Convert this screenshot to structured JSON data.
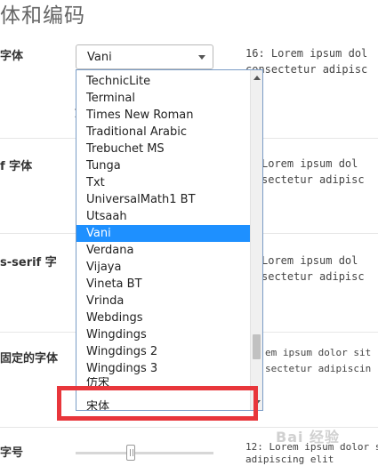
{
  "header": {
    "title": "体和编码"
  },
  "rows": {
    "standard": {
      "label": "字体",
      "preview": [
        "16: Lorem ipsum dol",
        "consectetur adipisc"
      ]
    },
    "serif": {
      "label": "f 字体",
      "preview": [
        "Lorem ipsum dol",
        "sectetur adipisc"
      ]
    },
    "sans": {
      "label": "s-serif 字",
      "preview": [
        "Lorem ipsum dol",
        "sectetur adipisc"
      ]
    },
    "fixed": {
      "label": "固定的字体",
      "preview": [
        "em ipsum dolor sit",
        "sectetur adipiscin"
      ]
    },
    "size": {
      "label": "字号",
      "preview": [
        "12: Lorem ipsum dolor sit a",
        "adipiscing elit"
      ]
    }
  },
  "font_select": {
    "value": "Vani",
    "options": [
      "TechnicLite",
      "Terminal",
      "Times New Roman",
      "Traditional Arabic",
      "Trebuchet MS",
      "Tunga",
      "Txt",
      "UniversalMath1 BT",
      "Utsaah",
      "Vani",
      "Verdana",
      "Vijaya",
      "Vineta BT",
      "Vrinda",
      "Webdings",
      "Wingdings",
      "Wingdings 2",
      "Wingdings 3"
    ],
    "selected_index": 9,
    "partial_option": "仿宋",
    "last_option": "宋体"
  },
  "fragments": {
    "under_select": "1"
  },
  "watermark": "Bai 经验"
}
